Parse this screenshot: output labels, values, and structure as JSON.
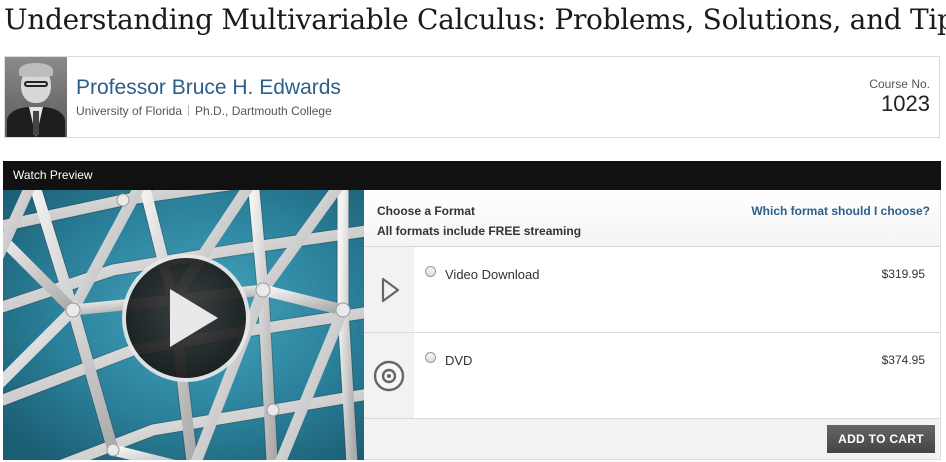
{
  "course": {
    "title": "Understanding Multivariable Calculus: Problems, Solutions, and Tips",
    "professor": "Professor Bruce H. Edwards",
    "affiliation": "University of Florida",
    "degree": "Ph.D., Dartmouth College",
    "course_label": "Course No.",
    "course_number": "1023"
  },
  "preview": {
    "label": "Watch Preview"
  },
  "format": {
    "title": "Choose a Format",
    "subtitle": "All formats include FREE streaming",
    "help_link": "Which format should I choose?",
    "options": [
      {
        "label": "Video Download",
        "price": "$319.95",
        "icon": "play-outline-icon",
        "selected": false
      },
      {
        "label": "DVD",
        "price": "$374.95",
        "icon": "disc-icon",
        "selected": false
      }
    ],
    "add_to_cart": "ADD TO CART"
  },
  "colors": {
    "accent": "#2c5e8c",
    "preview_bar": "#111111",
    "button": "#555555"
  }
}
